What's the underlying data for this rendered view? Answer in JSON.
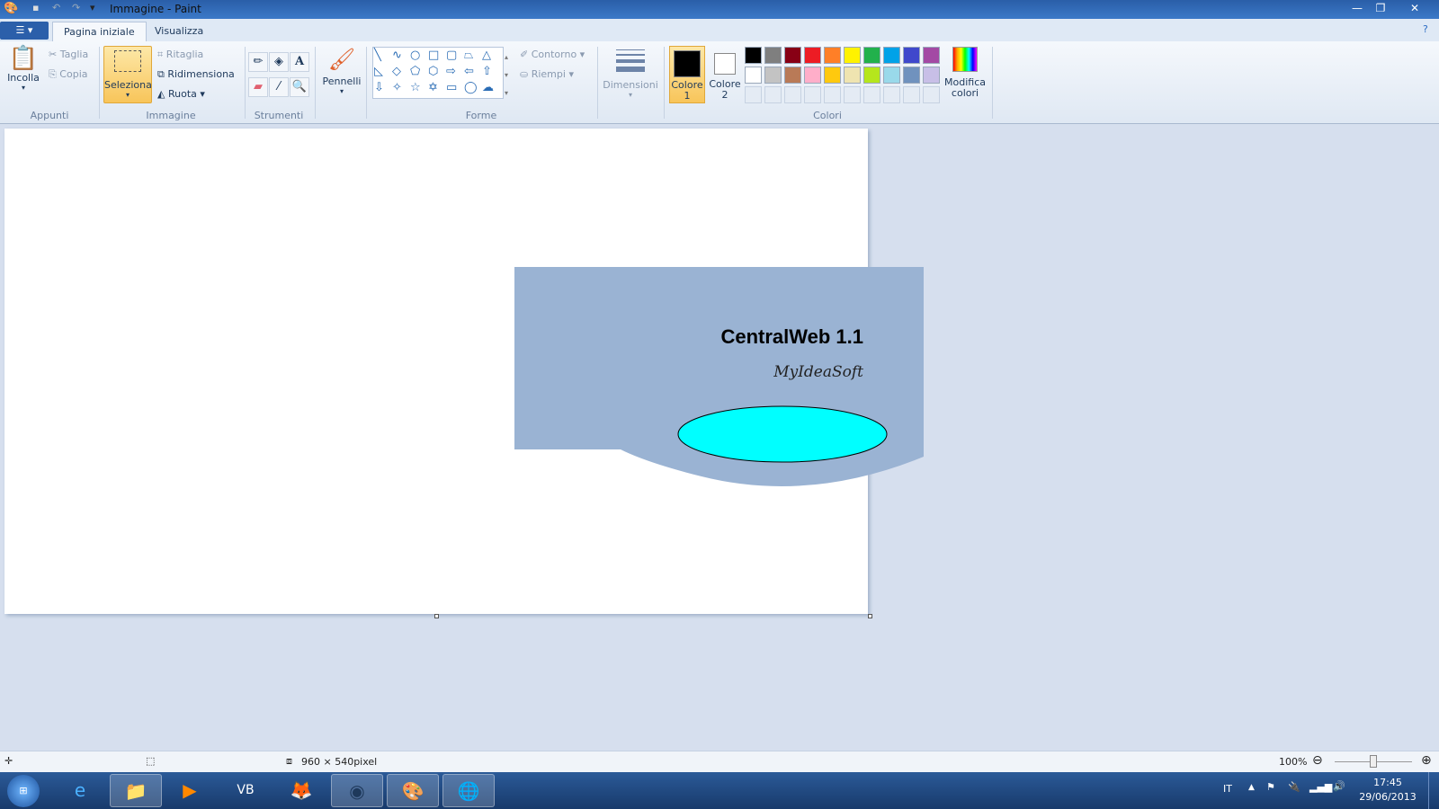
{
  "window": {
    "title": "Immagine - Paint"
  },
  "tabs": [
    {
      "label": "Pagina iniziale"
    },
    {
      "label": "Visualizza"
    }
  ],
  "ribbon": {
    "appunti": {
      "group": "Appunti",
      "paste": "Incolla",
      "cut": "Taglia",
      "copy": "Copia"
    },
    "immagine": {
      "group": "Immagine",
      "select": "Seleziona",
      "crop": "Ritaglia",
      "resize": "Ridimensiona",
      "rotate": "Ruota"
    },
    "strumenti": {
      "group": "Strumenti"
    },
    "brushes": "Pennelli",
    "forme": {
      "group": "Forme",
      "outline": "Contorno",
      "fill": "Riempi"
    },
    "size": "Dimensioni",
    "colori": {
      "group": "Colori",
      "color1": "Colore 1",
      "color2": "Colore 2",
      "edit": "Modifica colori",
      "row1": [
        "#000000",
        "#7f7f7f",
        "#880015",
        "#ed1c24",
        "#ff7f27",
        "#fff200",
        "#22b14c",
        "#00a2e8",
        "#3f48cc",
        "#a349a4"
      ],
      "row2": [
        "#ffffff",
        "#c3c3c3",
        "#b97a57",
        "#ffaec9",
        "#ffc90e",
        "#efe4b0",
        "#b5e61d",
        "#99d9ea",
        "#7092be",
        "#c8bfe7"
      ]
    }
  },
  "canvas": {
    "title": "CentralWeb 1.1",
    "subtitle": "MyIdeaSoft",
    "shape_color": "#9ab3d3",
    "ellipse_color": "#00ffff"
  },
  "status": {
    "size": "960 × 540pixel",
    "zoom": "100%",
    "zoom_value": 100
  },
  "taskbar": {
    "lang": "IT",
    "time": "17:45",
    "date": "29/06/2013"
  }
}
